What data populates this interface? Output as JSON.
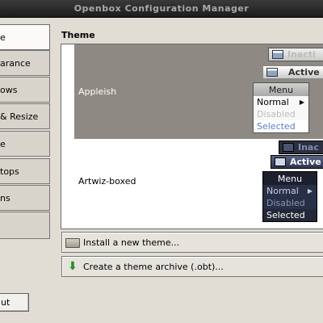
{
  "window": {
    "title": "Openbox Configuration Manager"
  },
  "nav": {
    "items": [
      {
        "label": "e",
        "active": true
      },
      {
        "label": "arance",
        "active": false
      },
      {
        "label": "ows",
        "active": false
      },
      {
        "label": "& Resize",
        "active": false
      },
      {
        "label": "e",
        "active": false
      },
      {
        "label": "tops",
        "active": false
      },
      {
        "label": "ns",
        "active": false
      }
    ],
    "bottom_button": "ut"
  },
  "theme_section": {
    "title": "Theme",
    "themes": [
      {
        "name": "Appleish",
        "selected": true,
        "preview": {
          "inactive_label": "Inacti",
          "active_label": "Active",
          "menu_title": "Menu",
          "menu_items": [
            "Normal",
            "Disabled",
            "Selected"
          ]
        }
      },
      {
        "name": "Artwiz-boxed",
        "selected": false,
        "preview": {
          "inactive_label": "Inac",
          "active_label": "Active",
          "menu_title": "Menu",
          "menu_items": [
            "Normal",
            "Disabled",
            "Selected"
          ]
        }
      }
    ]
  },
  "actions": {
    "install_label": "Install a new theme...",
    "create_archive_label": "Create a theme archive (.obt)..."
  },
  "icons": {
    "install": "folder-icon",
    "create_archive": "download-arrow-icon"
  },
  "colors": {
    "selected_row": "#8e8a83",
    "window_bg": "#e1ddd5",
    "titlebar": "#2a2a2a"
  }
}
